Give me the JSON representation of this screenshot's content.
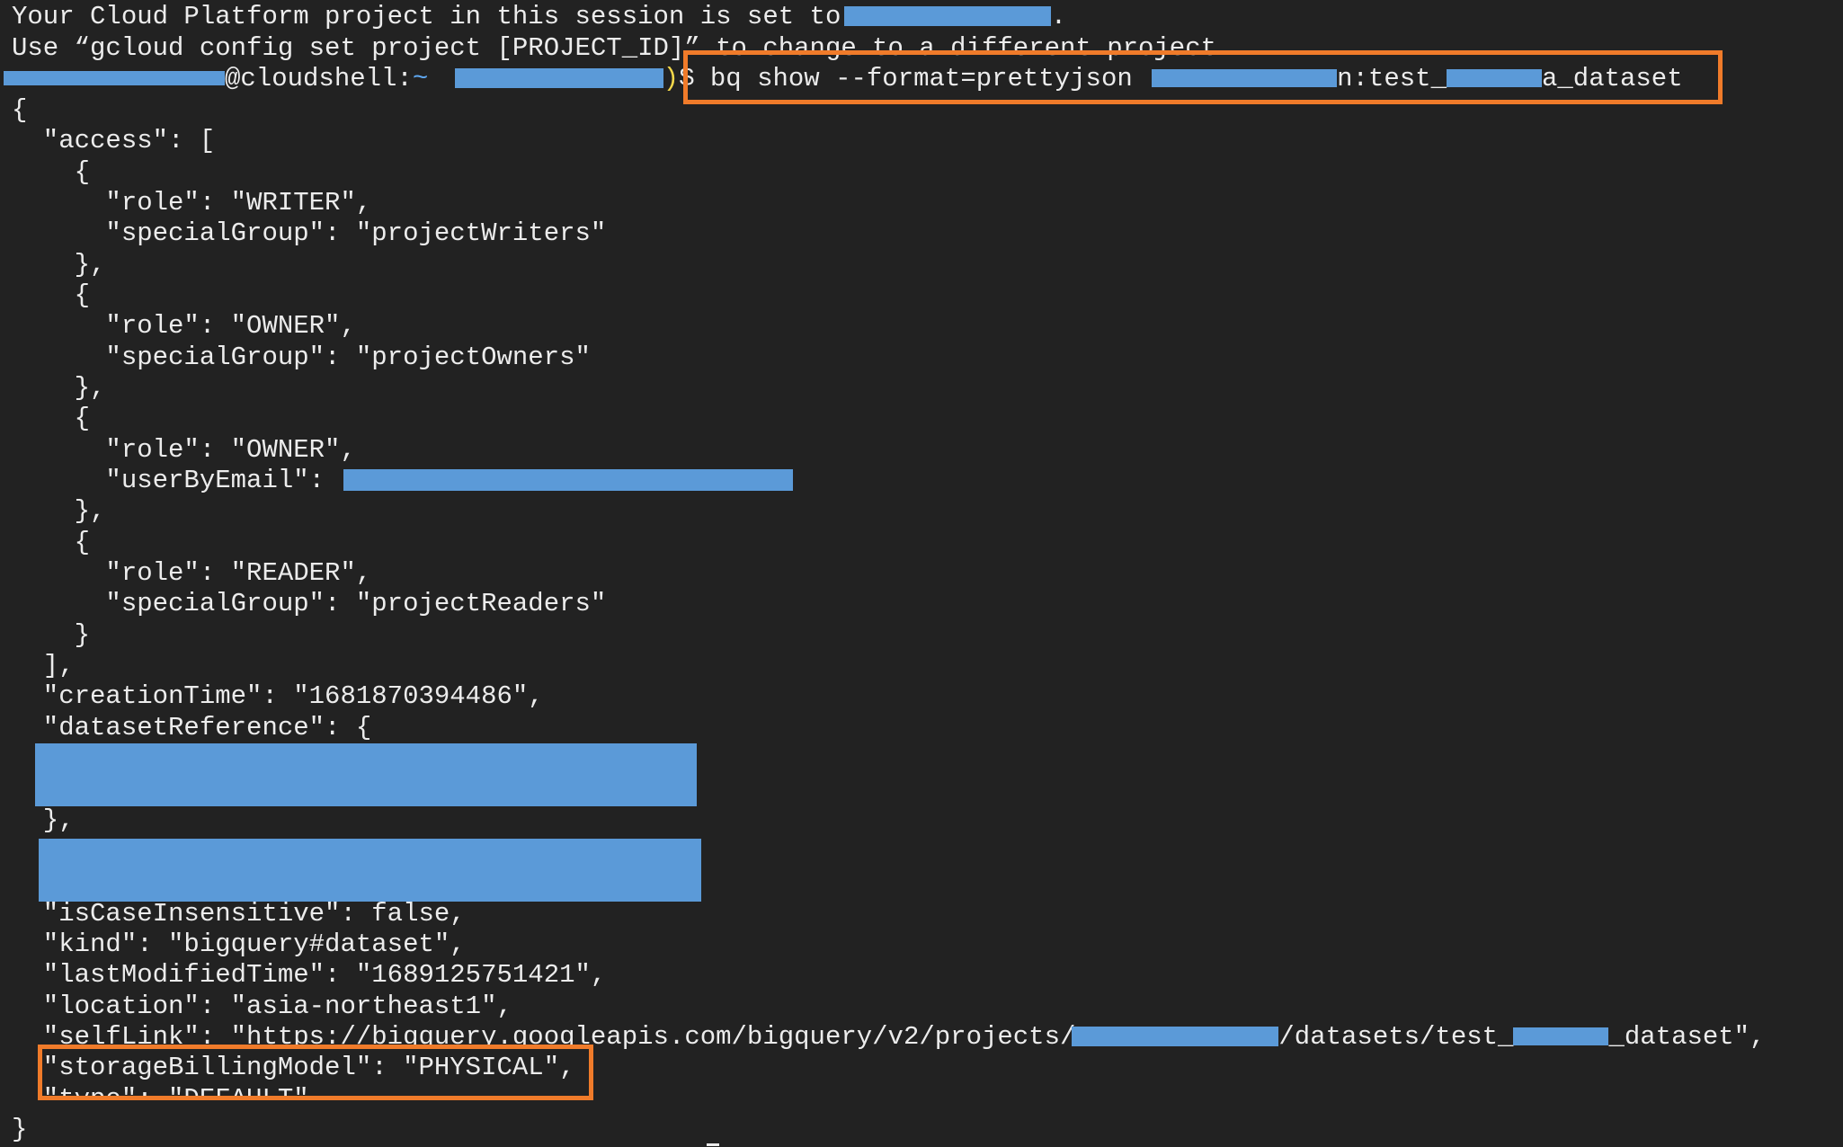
{
  "terminal": {
    "session_line_prefix": "Your Cloud Platform project in this session is set to ",
    "session_line_suffix": ".",
    "hint_line": "Use “gcloud config set project [PROJECT_ID]” to change to a different project.",
    "prompt": {
      "user_host": "@cloudshell:",
      "path": "~",
      "project_suffix": ")",
      "dollar": "$"
    },
    "command": {
      "text_prefix": "bq show --format=prettyjson ",
      "text_middle": "n:test_",
      "text_suffix": "a_dataset"
    },
    "output": {
      "open_brace": "{",
      "access_key": "  \"access\": [",
      "entries": [
        {
          "open": "    {",
          "line1": "      \"role\": \"WRITER\",",
          "line2": "      \"specialGroup\": \"projectWriters\"",
          "close": "    },"
        },
        {
          "open": "    {",
          "line1": "      \"role\": \"OWNER\",",
          "line2": "      \"specialGroup\": \"projectOwners\"",
          "close": "    },"
        },
        {
          "open": "    {",
          "line1": "      \"role\": \"OWNER\",",
          "line2": "      \"userByEmail\": ",
          "close": "    },"
        },
        {
          "open": "    {",
          "line1": "      \"role\": \"READER\",",
          "line2": "      \"specialGroup\": \"projectReaders\"",
          "close": "    }"
        }
      ],
      "access_close": "  ],",
      "creation_time": "  \"creationTime\": \"1681870394486\",",
      "dataset_reference": "  \"datasetReference\": {",
      "dataset_reference_close": "  },",
      "is_case_insensitive": "  \"isCaseInsensitive\": false,",
      "kind": "  \"kind\": \"bigquery#dataset\",",
      "last_modified": "  \"lastModifiedTime\": \"1689125751421\",",
      "location": "  \"location\": \"asia-northeast1\",",
      "self_link_prefix": "  \"selfLink\": \"https://bigquery.googleapis.com/bigquery/v2/projects/",
      "self_link_middle": "/datasets/test_",
      "self_link_suffix": "_dataset\",",
      "storage_billing_model": "  \"storageBillingModel\": \"PHYSICAL\",",
      "type_line": "  \"type\": \"DEFAULT\"",
      "close_brace": "}"
    },
    "colors": {
      "background": "#222222",
      "text": "#ececec",
      "redaction": "#5b9ad8",
      "highlight": "#f07b2a",
      "prompt_path": "#5fa8f2",
      "prompt_project": "#f3d74a"
    }
  }
}
